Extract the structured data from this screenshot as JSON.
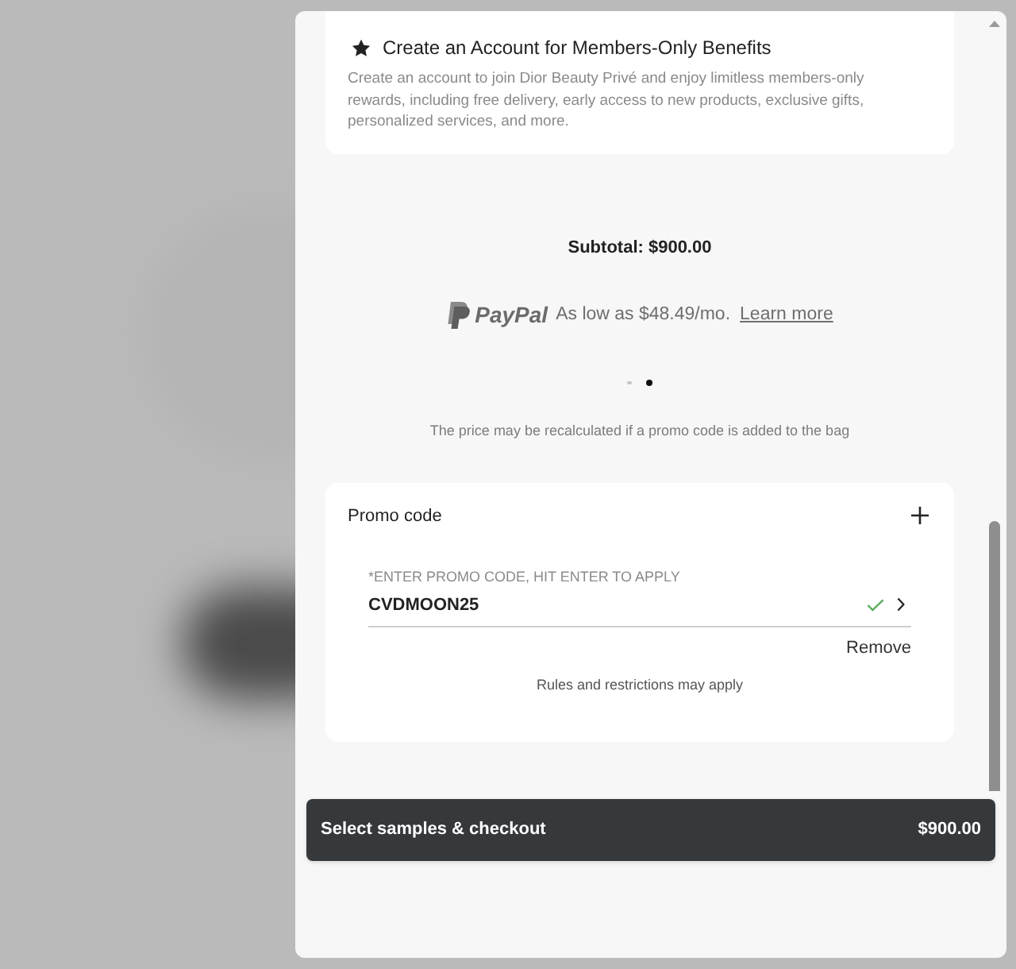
{
  "account_card": {
    "title": "Create an Account for Members-Only Benefits",
    "description": "Create an account to join Dior Beauty Privé and enjoy limitless members-only rewards, including free delivery, early access to new products, exclusive gifts, personalized services, and more."
  },
  "subtotal": "Subtotal: $900.00",
  "paypal": {
    "brand": "PayPal",
    "text": "As low as $48.49/mo.",
    "link": "Learn more"
  },
  "carousel_dots": [
    {
      "selected": false
    },
    {
      "selected": true
    }
  ],
  "price_note": "The price may be recalculated if a promo code is added to the bag",
  "promo": {
    "title": "Promo code",
    "field_label": "*ENTER PROMO CODE, HIT ENTER TO APPLY",
    "value": "CVDMOON25",
    "valid": true,
    "remove": "Remove",
    "rules": "Rules and restrictions may apply"
  },
  "checkout": {
    "label": "Select samples & checkout",
    "price": "$900.00"
  }
}
